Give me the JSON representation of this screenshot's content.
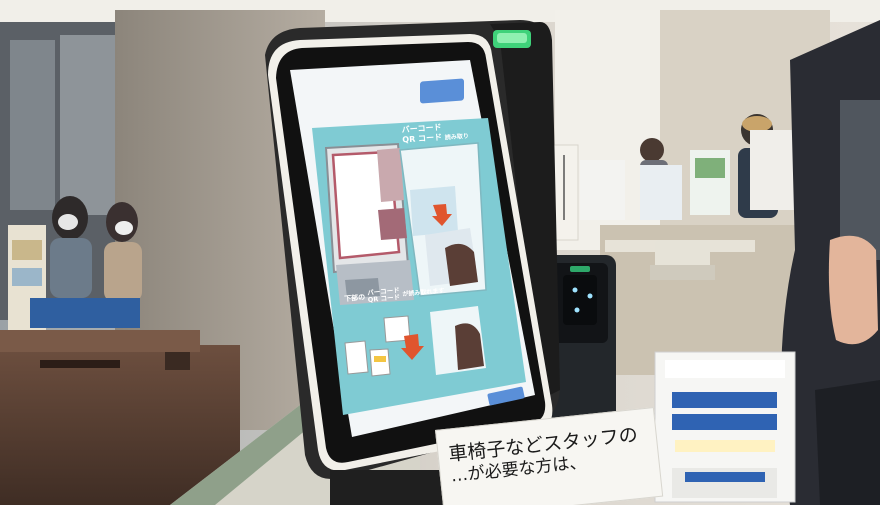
{
  "photo": {
    "subject": "Self-service barcode / QR code reception kiosk in an office lobby"
  },
  "kiosk_screen": {
    "top_button_label": "",
    "callout_title_line1": "バーコード",
    "callout_title_line2": "QR コード",
    "callout_title_suffix": "読み取り",
    "bottom_text_prefix": "下部の",
    "bottom_text_code1": "バーコード",
    "bottom_text_code2": "QR コード",
    "bottom_text_suffix": "が読み取れます",
    "bottom_right_button_label": ""
  },
  "desk_sign": {
    "line1": "車椅子などスタッフの",
    "line2": "…が必要な方は、"
  },
  "colors": {
    "screen_bg": "#f3f6f8",
    "panel_teal": "#7fcbd3",
    "arrow_red": "#e0552e",
    "button_blue": "#5a8fd8",
    "kiosk_frame": "#2a2a2a",
    "status_light": "#3fd27a"
  }
}
